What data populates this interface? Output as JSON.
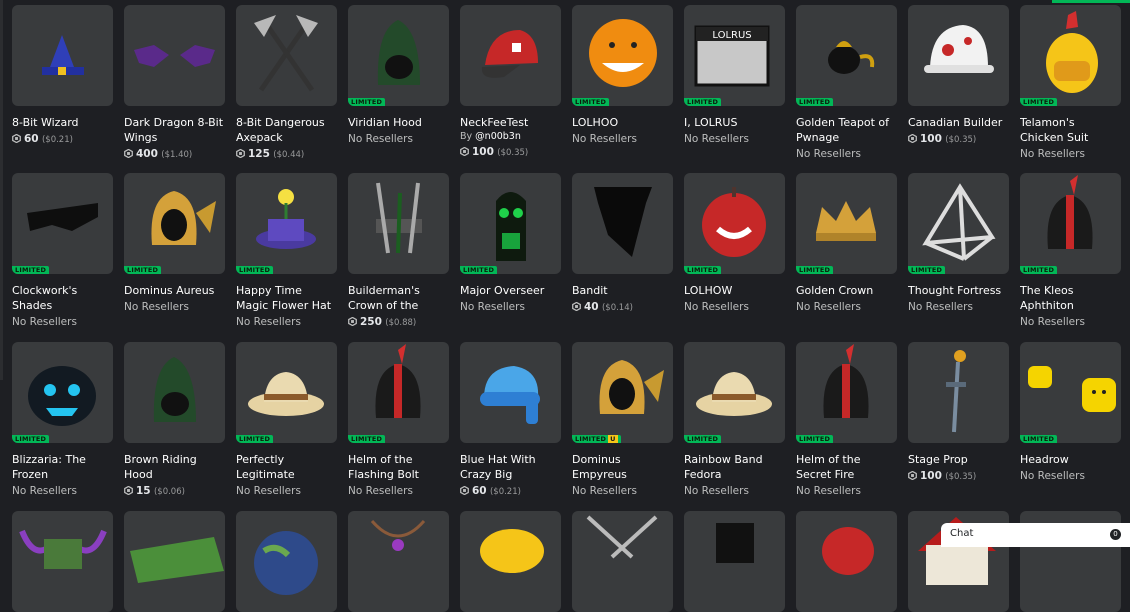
{
  "colors": {
    "background": "#1e1f23",
    "card": "#393b3d",
    "limited_badge": "#02b757",
    "unique_badge": "#f5c518"
  },
  "limited_label": "LIMITED",
  "unique_label": "U",
  "chat": {
    "label": "Chat",
    "count": "0"
  },
  "items": [
    {
      "name": "8-Bit Wizard",
      "icon": "wizard-hat-icon",
      "limited": false,
      "price": "60",
      "usd": "($0.21)"
    },
    {
      "name": "Dark Dragon 8-Bit Wings",
      "icon": "dragon-wings-icon",
      "limited": false,
      "price": "400",
      "usd": "($1.40)"
    },
    {
      "name": "8-Bit Dangerous Axepack",
      "icon": "axepack-icon",
      "limited": false,
      "price": "125",
      "usd": "($0.44)"
    },
    {
      "name": "Viridian Hood",
      "icon": "hood-icon",
      "limited": true,
      "status": "No Resellers"
    },
    {
      "name": "NeckFeeTest",
      "icon": "cap-icon",
      "limited": false,
      "creator_prefix": "By",
      "creator": "@n00b3n",
      "price": "100",
      "usd": "($0.35)"
    },
    {
      "name": "LOLHOO",
      "icon": "lol-face-icon",
      "limited": true,
      "status": "No Resellers"
    },
    {
      "name": "I, LOLRUS",
      "icon": "book-icon",
      "limited": true,
      "status": "No Resellers",
      "art_text": "LOLRUS"
    },
    {
      "name": "Golden Teapot of Pwnage",
      "icon": "teapot-icon",
      "limited": true,
      "status": "No Resellers"
    },
    {
      "name": "Canadian Builder",
      "icon": "hard-hat-icon",
      "limited": false,
      "price": "100",
      "usd": "($0.35)"
    },
    {
      "name": "Telamon's Chicken Suit",
      "icon": "chicken-icon",
      "limited": true,
      "status": "No Resellers"
    },
    {
      "name": "Clockwork's Shades",
      "icon": "shades-icon",
      "limited": true,
      "status": "No Resellers"
    },
    {
      "name": "Dominus Aureus",
      "icon": "dominus-icon",
      "limited": true,
      "status": "No Resellers"
    },
    {
      "name": "Happy Time Magic Flower Hat",
      "icon": "flower-hat-icon",
      "limited": true,
      "status": "No Resellers"
    },
    {
      "name": "Builderman's Crown of the",
      "icon": "crown-tools-icon",
      "limited": false,
      "price": "250",
      "usd": "($0.88)"
    },
    {
      "name": "Major Overseer",
      "icon": "overseer-icon",
      "limited": true,
      "status": "No Resellers"
    },
    {
      "name": "Bandit",
      "icon": "bandana-icon",
      "limited": false,
      "price": "40",
      "usd": "($0.14)"
    },
    {
      "name": "LOLHOW",
      "icon": "apple-icon",
      "limited": true,
      "status": "No Resellers"
    },
    {
      "name": "Golden Crown",
      "icon": "crown-icon",
      "limited": true,
      "status": "No Resellers"
    },
    {
      "name": "Thought Fortress",
      "icon": "pyramid-icon",
      "limited": true,
      "status": "No Resellers"
    },
    {
      "name": "The Kleos Aphthiton",
      "icon": "helmet-icon",
      "limited": true,
      "status": "No Resellers"
    },
    {
      "name": "Blizzaria: The Frozen",
      "icon": "pumpkin-icon",
      "limited": true,
      "status": "No Resellers"
    },
    {
      "name": "Brown Riding Hood",
      "icon": "hood-icon",
      "limited": false,
      "price": "15",
      "usd": "($0.06)"
    },
    {
      "name": "Perfectly Legitimate",
      "icon": "fedora-icon",
      "limited": true,
      "status": "No Resellers"
    },
    {
      "name": "Helm of the Flashing Bolt",
      "icon": "helmet-icon",
      "limited": true,
      "status": "No Resellers"
    },
    {
      "name": "Blue Hat With Crazy Big",
      "icon": "blue-hat-icon",
      "limited": false,
      "price": "60",
      "usd": "($0.21)"
    },
    {
      "name": "Dominus Empyreus",
      "icon": "dominus-icon",
      "limited": true,
      "unique": true,
      "status": "No Resellers"
    },
    {
      "name": "Rainbow Band Fedora",
      "icon": "fedora-icon",
      "limited": true,
      "status": "No Resellers"
    },
    {
      "name": "Helm of the Secret Fire",
      "icon": "helmet-icon",
      "limited": true,
      "status": "No Resellers"
    },
    {
      "name": "Stage Prop",
      "icon": "dagger-icon",
      "limited": false,
      "price": "100",
      "usd": "($0.35)"
    },
    {
      "name": "Headrow",
      "icon": "heads-icon",
      "limited": true,
      "status": "No Resellers"
    },
    {
      "name": "",
      "icon": "horned-helm-icon"
    },
    {
      "name": "",
      "icon": "tray-icon"
    },
    {
      "name": "",
      "icon": "globe-icon"
    },
    {
      "name": "",
      "icon": "necklace-icon"
    },
    {
      "name": "",
      "icon": "yellow-hat-icon"
    },
    {
      "name": "",
      "icon": "crossed-swords-icon"
    },
    {
      "name": "",
      "icon": "top-hat-icon"
    },
    {
      "name": "",
      "icon": "red-cap-icon"
    },
    {
      "name": "",
      "icon": "house-icon"
    },
    {
      "name": "",
      "icon": "blank-icon"
    }
  ]
}
